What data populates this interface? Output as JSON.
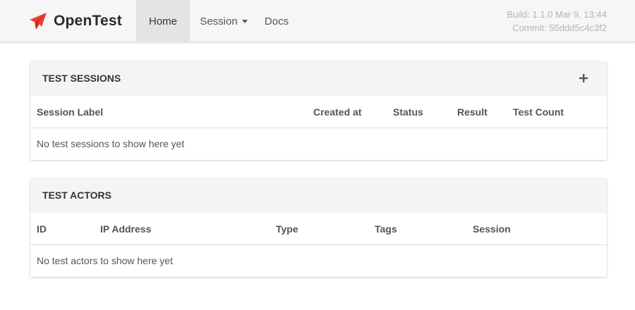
{
  "app": {
    "name": "OpenTest",
    "brand_color": "#ef3d2f"
  },
  "nav": {
    "home": "Home",
    "session": "Session",
    "docs": "Docs"
  },
  "build": {
    "build_line": "Build: 1.1.0 Mar 9, 13:44",
    "commit_line": "Commit: 55ddd5c4c3f2"
  },
  "sessions": {
    "title": "TEST SESSIONS",
    "add_icon": "plus-icon",
    "columns": [
      "Session Label",
      "Created at",
      "Status",
      "Result",
      "Test Count"
    ],
    "empty_text": "No test sessions to show here yet"
  },
  "actors": {
    "title": "TEST ACTORS",
    "columns": [
      "ID",
      "IP Address",
      "Type",
      "Tags",
      "Session"
    ],
    "empty_text": "No test actors to show here yet"
  }
}
